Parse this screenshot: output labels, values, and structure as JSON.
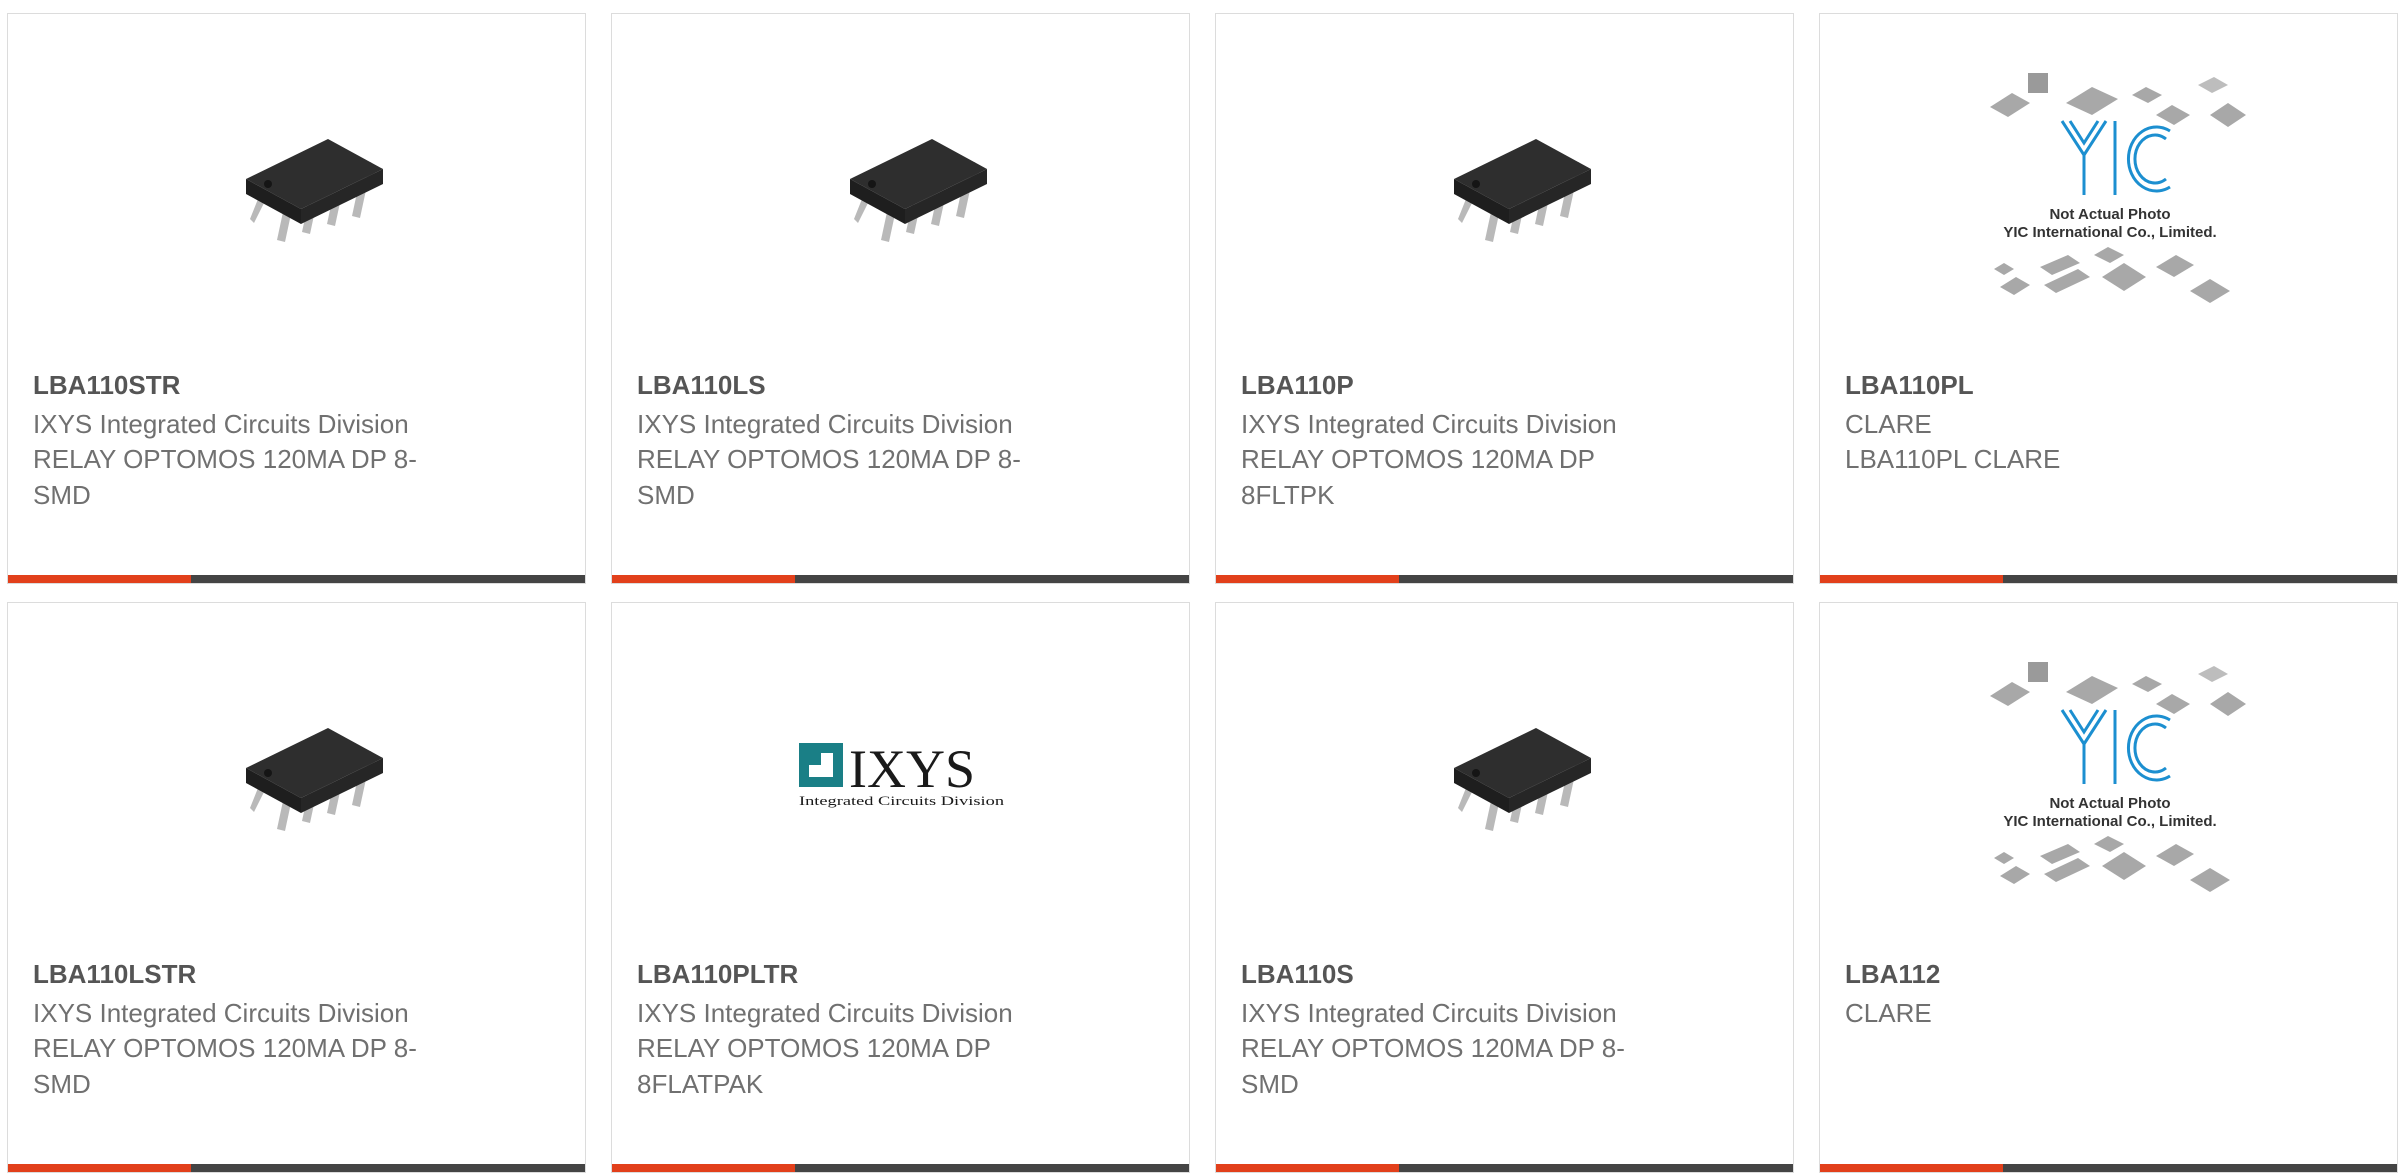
{
  "colors": {
    "accent": "#e2401b",
    "bar": "#444444",
    "part_text": "#555555",
    "body_text": "#707070",
    "border": "#dcdcdc"
  },
  "products": [
    {
      "part": "LBA110STR",
      "manufacturer": "IXYS Integrated Circuits Division",
      "description": "RELAY OPTOMOS 120MA DP 8-SMD",
      "image": "ic-chip-8dip-photo"
    },
    {
      "part": "LBA110LS",
      "manufacturer": "IXYS Integrated Circuits Division",
      "description": "RELAY OPTOMOS 120MA DP 8-SMD",
      "image": "ic-chip-8dip-photo"
    },
    {
      "part": "LBA110P",
      "manufacturer": "IXYS Integrated Circuits Division",
      "description": "RELAY OPTOMOS 120MA DP 8FLTPK",
      "image": "ic-chip-8dip-photo"
    },
    {
      "part": "LBA110PL",
      "manufacturer": "CLARE",
      "description": "LBA110PL CLARE",
      "image": "yic-placeholder",
      "placeholder_line1": "Not Actual Photo",
      "placeholder_line2": "YIC International Co., Limited."
    },
    {
      "part": "LBA110LSTR",
      "manufacturer": "IXYS Integrated Circuits Division",
      "description": "RELAY OPTOMOS 120MA DP 8-SMD",
      "image": "ic-chip-8dip-photo"
    },
    {
      "part": "LBA110PLTR",
      "manufacturer": "IXYS Integrated Circuits Division",
      "description": "RELAY OPTOMOS 120MA DP 8FLATPAK",
      "image": "ixys-logo",
      "logo_text": "IXYS",
      "logo_subtext": "Integrated Circuits Division"
    },
    {
      "part": "LBA110S",
      "manufacturer": "IXYS Integrated Circuits Division",
      "description": "RELAY OPTOMOS 120MA DP 8-SMD",
      "image": "ic-chip-8dip-photo"
    },
    {
      "part": "LBA112",
      "manufacturer": "CLARE",
      "description": "",
      "image": "yic-placeholder",
      "placeholder_line1": "Not Actual Photo",
      "placeholder_line2": "YIC International Co., Limited."
    }
  ]
}
